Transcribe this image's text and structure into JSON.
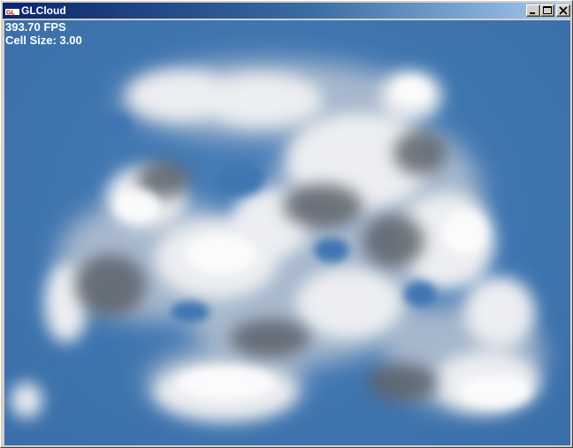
{
  "window": {
    "title": "GLCloud",
    "icon": "app-icon"
  },
  "controls": {
    "minimize_icon": "minimize-icon",
    "maximize_icon": "maximize-icon",
    "close_icon": "close-icon"
  },
  "hud": {
    "fps": "393.70 FPS",
    "cell_size": "Cell Size: 3.00"
  },
  "colors": {
    "sky": "#3f74ae",
    "cloud_light": "#f2f2f4",
    "cloud_shadow": "#4a5058",
    "titlebar_start": "#0a246a",
    "titlebar_end": "#a6caf0"
  }
}
